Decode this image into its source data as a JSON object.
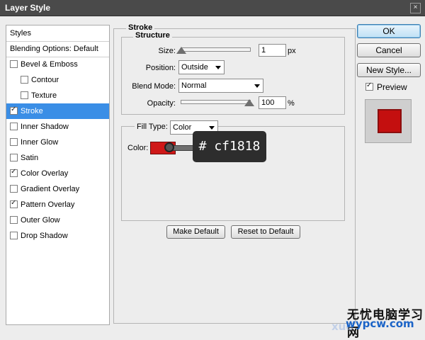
{
  "window": {
    "title": "Layer Style",
    "close_glyph": "×"
  },
  "left_panel": {
    "items": [
      {
        "label": "Styles",
        "checked": null,
        "selected": false,
        "indent": 0,
        "header": true
      },
      {
        "label": "Blending Options: Default",
        "checked": null,
        "selected": false,
        "indent": 0,
        "header": true
      },
      {
        "label": "Bevel & Emboss",
        "checked": false,
        "selected": false,
        "indent": 0
      },
      {
        "label": "Contour",
        "checked": false,
        "selected": false,
        "indent": 1
      },
      {
        "label": "Texture",
        "checked": false,
        "selected": false,
        "indent": 1
      },
      {
        "label": "Stroke",
        "checked": true,
        "selected": true,
        "indent": 0
      },
      {
        "label": "Inner Shadow",
        "checked": false,
        "selected": false,
        "indent": 0
      },
      {
        "label": "Inner Glow",
        "checked": false,
        "selected": false,
        "indent": 0
      },
      {
        "label": "Satin",
        "checked": false,
        "selected": false,
        "indent": 0
      },
      {
        "label": "Color Overlay",
        "checked": true,
        "selected": false,
        "indent": 0
      },
      {
        "label": "Gradient Overlay",
        "checked": false,
        "selected": false,
        "indent": 0
      },
      {
        "label": "Pattern Overlay",
        "checked": true,
        "selected": false,
        "indent": 0
      },
      {
        "label": "Outer Glow",
        "checked": false,
        "selected": false,
        "indent": 0
      },
      {
        "label": "Drop Shadow",
        "checked": false,
        "selected": false,
        "indent": 0
      }
    ]
  },
  "stroke": {
    "title": "Stroke",
    "structure_title": "Structure",
    "size": {
      "label": "Size:",
      "value": "1",
      "unit": "px",
      "fraction": 0.0
    },
    "position": {
      "label": "Position:",
      "value": "Outside"
    },
    "blend_mode": {
      "label": "Blend Mode:",
      "value": "Normal"
    },
    "opacity": {
      "label": "Opacity:",
      "value": "100",
      "unit": "%",
      "fraction": 1.0
    },
    "fill_type": {
      "label": "Fill Type:",
      "value": "Color"
    },
    "color": {
      "label": "Color:",
      "hex": "#cf1818",
      "tooltip": "# cf1818"
    }
  },
  "bottom_buttons": {
    "make_default": "Make Default",
    "reset_default": "Reset to Default"
  },
  "right": {
    "ok": "OK",
    "cancel": "Cancel",
    "new_style": "New Style...",
    "preview_label": "Preview",
    "preview_checked": true,
    "preview_color": "#c40f0f"
  },
  "watermark": {
    "cn": "无忧电脑学习网",
    "en": "wypcw.com",
    "ghost": "xue"
  }
}
